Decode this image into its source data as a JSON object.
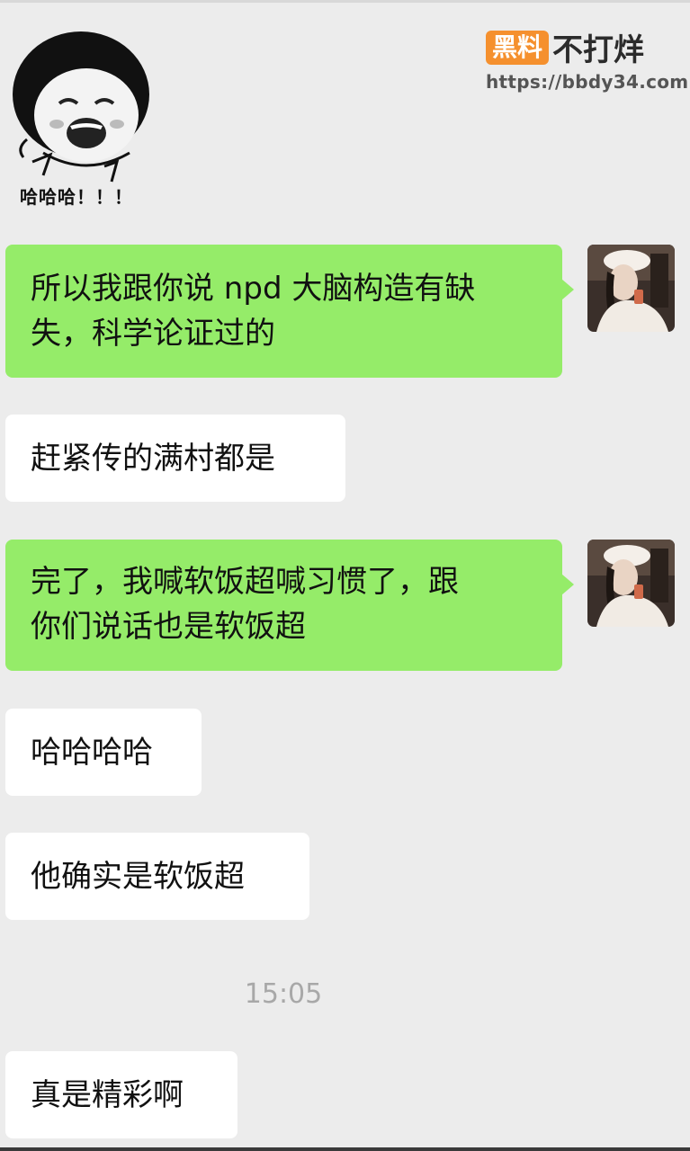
{
  "watermark": {
    "badge": "黑料",
    "title": "不打烊",
    "url": "https://bbdy34.com"
  },
  "sticker": {
    "icon": "laughing-meme-sticker",
    "caption": "哈哈哈！！！"
  },
  "messages": [
    {
      "side": "right",
      "text": "所以我跟你说npd大脑构造有缺失，科学论证过的",
      "lines": [
        "所以我跟你说 npd 大脑构造有缺",
        "失，科学论证过的"
      ]
    },
    {
      "side": "left",
      "text": "赶紧传的满村都是"
    },
    {
      "side": "right",
      "text": "完了，我喊软饭超喊习惯了，跟你们说话也是软饭超",
      "lines": [
        "完了，我喊软饭超喊习惯了，跟",
        "你们说话也是软饭超"
      ]
    },
    {
      "side": "left",
      "text": "哈哈哈哈"
    },
    {
      "side": "left",
      "text": "他确实是软饭超"
    },
    {
      "side": "left",
      "text": "真是精彩啊"
    }
  ],
  "timestamp": "15:05",
  "colors": {
    "background": "#ececec",
    "sent_bubble": "#95ec69",
    "received_bubble": "#ffffff",
    "watermark_badge": "#f5902e"
  }
}
